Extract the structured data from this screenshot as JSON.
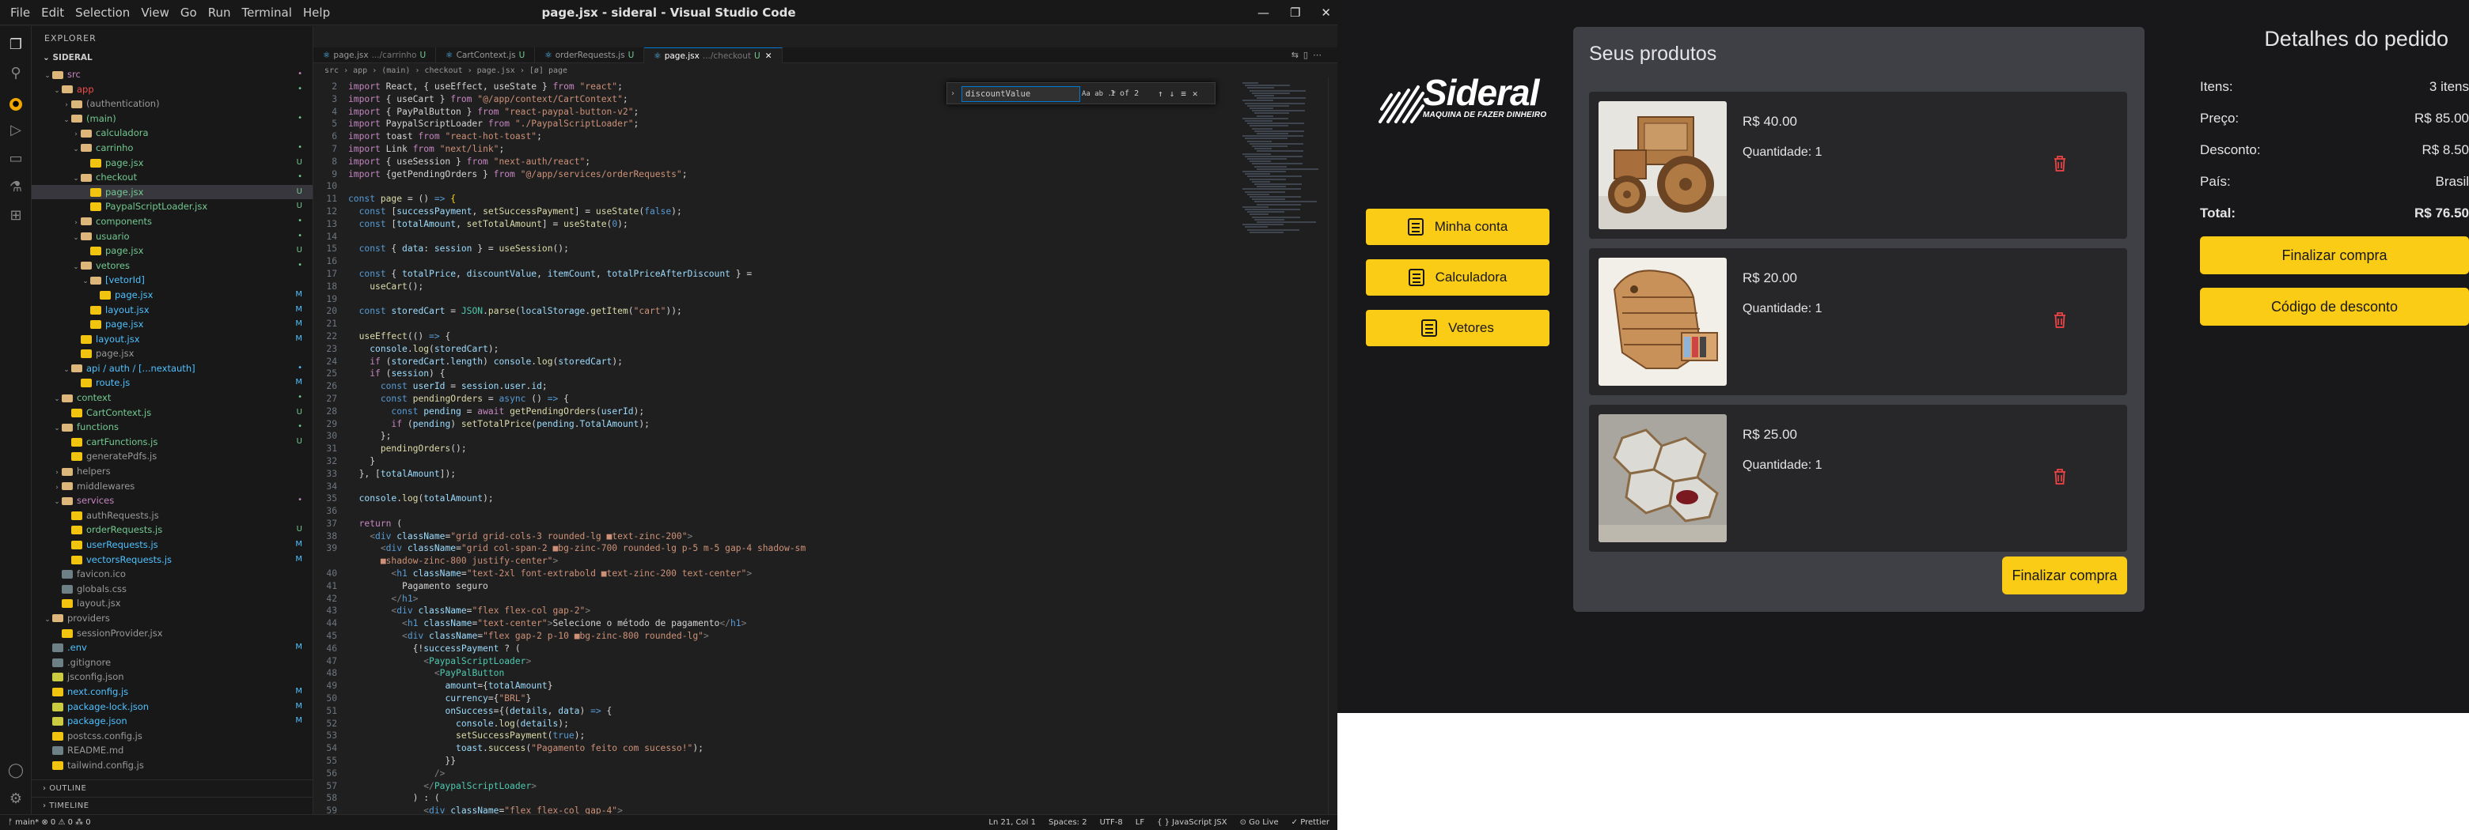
{
  "vscode": {
    "title": "page.jsx - sideral - Visual Studio Code",
    "menu": [
      "File",
      "Edit",
      "Selection",
      "View",
      "Go",
      "Run",
      "Terminal",
      "Help"
    ],
    "explorer_label": "EXPLORER",
    "root": "SIDERAL",
    "tree": [
      {
        "label": "src",
        "depth": 0,
        "folder": true,
        "open": true,
        "color": "#c586c0",
        "status": "•",
        "scolor": "#c586c0"
      },
      {
        "label": "app",
        "depth": 1,
        "folder": true,
        "open": true,
        "color": "#f14c4c",
        "status": "•",
        "scolor": "#73c991"
      },
      {
        "label": "(authentication)",
        "depth": 2,
        "folder": true,
        "open": false,
        "color": "#999",
        "status": "",
        "scolor": ""
      },
      {
        "label": "(main)",
        "depth": 2,
        "folder": true,
        "open": true,
        "color": "#73c991",
        "status": "•",
        "scolor": "#73c991"
      },
      {
        "label": "calculadora",
        "depth": 3,
        "folder": true,
        "open": false,
        "color": "#73c991",
        "status": "",
        "scolor": ""
      },
      {
        "label": "carrinho",
        "depth": 3,
        "folder": true,
        "open": true,
        "color": "#73c991",
        "status": "•",
        "scolor": "#73c991"
      },
      {
        "label": "page.jsx",
        "depth": 4,
        "folder": false,
        "color": "#73c991",
        "status": "U",
        "scolor": "#73c991"
      },
      {
        "label": "checkout",
        "depth": 3,
        "folder": true,
        "open": true,
        "color": "#73c991",
        "status": "•",
        "scolor": "#73c991"
      },
      {
        "label": "page.jsx",
        "depth": 4,
        "folder": false,
        "color": "#73c991",
        "status": "U",
        "scolor": "#73c991",
        "selected": true
      },
      {
        "label": "PaypalScriptLoader.jsx",
        "depth": 4,
        "folder": false,
        "color": "#73c991",
        "status": "U",
        "scolor": "#73c991"
      },
      {
        "label": "components",
        "depth": 3,
        "folder": true,
        "open": false,
        "color": "#73c991",
        "status": "•",
        "scolor": "#73c991"
      },
      {
        "label": "usuario",
        "depth": 3,
        "folder": true,
        "open": true,
        "color": "#73c991",
        "status": "•",
        "scolor": "#73c991"
      },
      {
        "label": "page.jsx",
        "depth": 4,
        "folder": false,
        "color": "#73c991",
        "status": "U",
        "scolor": "#73c991"
      },
      {
        "label": "vetores",
        "depth": 3,
        "folder": true,
        "open": true,
        "color": "#73c991",
        "status": "•",
        "scolor": "#73c991"
      },
      {
        "label": "[vetorId]",
        "depth": 4,
        "folder": true,
        "open": true,
        "color": "#4fc1ff",
        "status": "",
        "scolor": ""
      },
      {
        "label": "page.jsx",
        "depth": 5,
        "folder": false,
        "color": "#4fc1ff",
        "status": "M",
        "scolor": "#4fc1ff"
      },
      {
        "label": "layout.jsx",
        "depth": 4,
        "folder": false,
        "color": "#4fc1ff",
        "status": "M",
        "scolor": "#4fc1ff"
      },
      {
        "label": "page.jsx",
        "depth": 4,
        "folder": false,
        "color": "#4fc1ff",
        "status": "M",
        "scolor": "#4fc1ff"
      },
      {
        "label": "layout.jsx",
        "depth": 3,
        "folder": false,
        "color": "#4fc1ff",
        "status": "M",
        "scolor": "#4fc1ff"
      },
      {
        "label": "page.jsx",
        "depth": 3,
        "folder": false,
        "color": "#999",
        "status": "",
        "scolor": ""
      },
      {
        "label": "api / auth / [...nextauth]",
        "depth": 2,
        "folder": true,
        "open": true,
        "color": "#4fc1ff",
        "status": "•",
        "scolor": "#4fc1ff"
      },
      {
        "label": "route.js",
        "depth": 3,
        "folder": false,
        "color": "#4fc1ff",
        "status": "M",
        "scolor": "#4fc1ff"
      },
      {
        "label": "context",
        "depth": 1,
        "folder": true,
        "open": true,
        "color": "#73c991",
        "status": "•",
        "scolor": "#73c991"
      },
      {
        "label": "CartContext.js",
        "depth": 2,
        "folder": false,
        "color": "#73c991",
        "status": "U",
        "scolor": "#73c991"
      },
      {
        "label": "functions",
        "depth": 1,
        "folder": true,
        "open": true,
        "color": "#73c991",
        "status": "•",
        "scolor": "#73c991"
      },
      {
        "label": "cartFunctions.js",
        "depth": 2,
        "folder": false,
        "color": "#73c991",
        "status": "U",
        "scolor": "#73c991"
      },
      {
        "label": "generatePdfs.js",
        "depth": 2,
        "folder": false,
        "color": "#999",
        "status": "",
        "scolor": ""
      },
      {
        "label": "helpers",
        "depth": 1,
        "folder": true,
        "open": false,
        "color": "#999",
        "status": "",
        "scolor": ""
      },
      {
        "label": "middlewares",
        "depth": 1,
        "folder": true,
        "open": false,
        "color": "#999",
        "status": "",
        "scolor": ""
      },
      {
        "label": "services",
        "depth": 1,
        "folder": true,
        "open": true,
        "color": "#c586c0",
        "status": "•",
        "scolor": "#c586c0"
      },
      {
        "label": "authRequests.js",
        "depth": 2,
        "folder": false,
        "color": "#999",
        "status": "",
        "scolor": ""
      },
      {
        "label": "orderRequests.js",
        "depth": 2,
        "folder": false,
        "color": "#73c991",
        "status": "U",
        "scolor": "#73c991"
      },
      {
        "label": "userRequests.js",
        "depth": 2,
        "folder": false,
        "color": "#4fc1ff",
        "status": "M",
        "scolor": "#4fc1ff"
      },
      {
        "label": "vectorsRequests.js",
        "depth": 2,
        "folder": false,
        "color": "#4fc1ff",
        "status": "M",
        "scolor": "#4fc1ff"
      },
      {
        "label": "favicon.ico",
        "depth": 1,
        "folder": false,
        "color": "#999",
        "status": "",
        "scolor": ""
      },
      {
        "label": "globals.css",
        "depth": 1,
        "folder": false,
        "color": "#999",
        "status": "",
        "scolor": ""
      },
      {
        "label": "layout.jsx",
        "depth": 1,
        "folder": false,
        "color": "#999",
        "status": "",
        "scolor": ""
      },
      {
        "label": "providers",
        "depth": 0,
        "folder": true,
        "open": true,
        "color": "#999",
        "status": "",
        "scolor": ""
      },
      {
        "label": "sessionProvider.jsx",
        "depth": 1,
        "folder": false,
        "color": "#999",
        "status": "",
        "scolor": ""
      },
      {
        "label": ".env",
        "depth": 0,
        "folder": false,
        "color": "#4fc1ff",
        "status": "M",
        "scolor": "#4fc1ff"
      },
      {
        "label": ".gitignore",
        "depth": 0,
        "folder": false,
        "color": "#999",
        "status": "",
        "scolor": ""
      },
      {
        "label": "jsconfig.json",
        "depth": 0,
        "folder": false,
        "color": "#999",
        "status": "",
        "scolor": ""
      },
      {
        "label": "next.config.js",
        "depth": 0,
        "folder": false,
        "color": "#4fc1ff",
        "status": "M",
        "scolor": "#4fc1ff"
      },
      {
        "label": "package-lock.json",
        "depth": 0,
        "folder": false,
        "color": "#4fc1ff",
        "status": "M",
        "scolor": "#4fc1ff"
      },
      {
        "label": "package.json",
        "depth": 0,
        "folder": false,
        "color": "#4fc1ff",
        "status": "M",
        "scolor": "#4fc1ff"
      },
      {
        "label": "postcss.config.js",
        "depth": 0,
        "folder": false,
        "color": "#999",
        "status": "",
        "scolor": ""
      },
      {
        "label": "README.md",
        "depth": 0,
        "folder": false,
        "color": "#999",
        "status": "",
        "scolor": ""
      },
      {
        "label": "tailwind.config.js",
        "depth": 0,
        "folder": false,
        "color": "#999",
        "status": "",
        "scolor": ""
      }
    ],
    "outline_label": "OUTLINE",
    "timeline_label": "TIMELINE",
    "tabs": [
      {
        "label": "page.jsx",
        "sub": ".../carrinho",
        "status": "U",
        "active": false
      },
      {
        "label": "CartContext.js",
        "sub": "",
        "status": "U",
        "active": false
      },
      {
        "label": "orderRequests.js",
        "sub": "",
        "status": "U",
        "active": false
      },
      {
        "label": "page.jsx",
        "sub": ".../checkout",
        "status": "U",
        "active": true
      }
    ],
    "breadcrumb": "src › app › (main) › checkout › page.jsx › [ø] page",
    "find": {
      "value": "discountValue",
      "count": "1 of 2",
      "options": "Aa ab .*"
    },
    "code_lines": [
      "<span class='k'>import</span> React, { useEffect, useState } <span class='k'>from</span> <span class='s'>\"react\"</span>;",
      "<span class='k'>import</span> { useCart } <span class='k'>from</span> <span class='s'>\"@/app/context/CartContext\"</span>;",
      "<span class='k'>import</span> { PayPalButton } <span class='k'>from</span> <span class='s'>\"react-paypal-button-v2\"</span>;",
      "<span class='k'>import</span> PaypalScriptLoader <span class='k'>from</span> <span class='s'>\"./PaypalScriptLoader\"</span>;",
      "<span class='k'>import</span> toast <span class='k'>from</span> <span class='s'>\"react-hot-toast\"</span>;",
      "<span class='k'>import</span> Link <span class='k'>from</span> <span class='s'>\"next/link\"</span>;",
      "<span class='k'>import</span> { useSession } <span class='k'>from</span> <span class='s'>\"next-auth/react\"</span>;",
      "<span class='k'>import</span> {getPendingOrders } <span class='k'>from</span> <span class='s'>\"@/app/services/orderRequests\"</span>;",
      "",
      "<span class='b'>const</span> <span class='f'>page</span> = () <span class='b'>=&gt;</span> <span class='y'>{</span>",
      "  <span class='b'>const</span> [<span class='v'>successPayment</span>, <span class='f'>setSuccessPayment</span>] = <span class='f'>useState</span>(<span class='b'>false</span>);",
      "  <span class='b'>const</span> [<span class='v'>totalAmount</span>, <span class='f'>setTotalAmount</span>] = <span class='f'>useState</span>(<span class='b'>0</span>);",
      "",
      "  <span class='b'>const</span> { <span class='v'>data</span>: <span class='v'>session</span> } = <span class='f'>useSession</span>();",
      "",
      "  <span class='b'>const</span> { <span class='v'>totalPrice</span>, <span class='v'>discountValue</span>, <span class='v'>itemCount</span>, <span class='v'>totalPriceAfterDiscount</span> } =",
      "    <span class='f'>useCart</span>();",
      "",
      "  <span class='b'>const</span> <span class='v'>storedCart</span> = <span class='t'>JSON</span>.<span class='f'>parse</span>(<span class='v'>localStorage</span>.<span class='f'>getItem</span>(<span class='s'>\"cart\"</span>));",
      "",
      "  <span class='f'>useEffect</span>(() <span class='b'>=&gt;</span> {",
      "    <span class='v'>console</span>.<span class='f'>log</span>(<span class='v'>storedCart</span>);",
      "    <span class='k'>if</span> (<span class='v'>storedCart</span>.<span class='v'>length</span>) <span class='v'>console</span>.<span class='f'>log</span>(<span class='v'>storedCart</span>);",
      "    <span class='k'>if</span> (<span class='v'>session</span>) {",
      "      <span class='b'>const</span> <span class='v'>userId</span> = <span class='v'>session</span>.<span class='v'>user</span>.<span class='v'>id</span>;",
      "      <span class='b'>const</span> <span class='f'>pendingOrders</span> = <span class='b'>async</span> () <span class='b'>=&gt;</span> {",
      "        <span class='b'>const</span> <span class='v'>pending</span> = <span class='k'>await</span> <span class='f'>getPendingOrders</span>(<span class='v'>userId</span>);",
      "        <span class='k'>if</span> (<span class='v'>pending</span>) <span class='f'>setTotalPrice</span>(<span class='v'>pending</span>.<span class='v'>TotalAmount</span>);",
      "      };",
      "      <span class='f'>pendingOrders</span>();",
      "    }",
      "  }, [<span class='v'>totalAmount</span>]);",
      "",
      "  <span class='v'>console</span>.<span class='f'>log</span>(<span class='v'>totalAmount</span>);",
      "",
      "  <span class='k'>return</span> (",
      "    <span class='g'>&lt;</span><span class='b'>div</span> <span class='v'>className</span>=<span class='s'>\"grid grid-cols-3 rounded-lg ■text-zinc-200\"</span><span class='g'>&gt;</span>",
      "      <span class='g'>&lt;</span><span class='b'>div</span> <span class='v'>className</span>=<span class='s'>\"grid col-span-2 ■bg-zinc-700 rounded-lg p-5 m-5 gap-4 shadow-sm</span>",
      "      <span class='s'>■shadow-zinc-800 justify-center\"</span><span class='g'>&gt;</span>",
      "        <span class='g'>&lt;</span><span class='b'>h1</span> <span class='v'>className</span>=<span class='s'>\"text-2xl font-extrabold ■text-zinc-200 text-center\"</span><span class='g'>&gt;</span>",
      "          Pagamento seguro",
      "        <span class='g'>&lt;/</span><span class='b'>h1</span><span class='g'>&gt;</span>",
      "        <span class='g'>&lt;</span><span class='b'>div</span> <span class='v'>className</span>=<span class='s'>\"flex flex-col gap-2\"</span><span class='g'>&gt;</span>",
      "          <span class='g'>&lt;</span><span class='b'>h1</span> <span class='v'>className</span>=<span class='s'>\"text-center\"</span><span class='g'>&gt;</span>Selecione o método de pagamento<span class='g'>&lt;/</span><span class='b'>h1</span><span class='g'>&gt;</span>",
      "          <span class='g'>&lt;</span><span class='b'>div</span> <span class='v'>className</span>=<span class='s'>\"flex gap-2 p-10 ■bg-zinc-800 rounded-lg\"</span><span class='g'>&gt;</span>",
      "            {!<span class='v'>successPayment</span> ? (",
      "              <span class='g'>&lt;</span><span class='t'>PaypalScriptLoader</span><span class='g'>&gt;</span>",
      "                <span class='g'>&lt;</span><span class='t'>PayPalButton</span>",
      "                  <span class='v'>amount</span>={<span class='v'>totalAmount</span>}",
      "                  <span class='v'>currency</span>={<span class='s'>\"BRL\"</span>}",
      "                  <span class='v'>onSuccess</span>={(<span class='v'>details</span>, <span class='v'>data</span>) <span class='b'>=&gt;</span> {",
      "                    <span class='v'>console</span>.<span class='f'>log</span>(<span class='v'>details</span>);",
      "                    <span class='f'>setSuccessPayment</span>(<span class='b'>true</span>);",
      "                    <span class='v'>toast</span>.<span class='f'>success</span>(<span class='s'>\"Pagamento feito com sucesso!\"</span>);",
      "                  }}",
      "                <span class='g'>/&gt;</span>",
      "              <span class='g'>&lt;/</span><span class='t'>PaypalScriptLoader</span><span class='g'>&gt;</span>",
      "            ) : (",
      "              <span class='g'>&lt;</span><span class='b'>div</span> <span class='v'>className</span>=<span class='s'>\"flex flex-col gap-4\"</span><span class='g'>&gt;</span>"
    ],
    "line_numbers": [
      "2",
      "3",
      "4",
      "5",
      "6",
      "7",
      "8",
      "9",
      "10",
      "11",
      "12",
      "13",
      "14",
      "15",
      "16",
      "17",
      "18",
      "19",
      "20",
      "21",
      "22",
      "23",
      "24",
      "25",
      "26",
      "27",
      "28",
      "29",
      "30",
      "31",
      "32",
      "33",
      "34",
      "35",
      "36",
      "37",
      "38",
      "39",
      "",
      "40",
      "41",
      "42",
      "43",
      "44",
      "45",
      "46",
      "47",
      "48",
      "49",
      "50",
      "51",
      "52",
      "53",
      "54",
      "55",
      "56",
      "57",
      "58",
      "59"
    ],
    "status_left": "ᚠ main*  ⊗ 0 ⚠ 0   ⁂ 0",
    "status_right": [
      "Ln 21, Col 1",
      "Spaces: 2",
      "UTF-8",
      "LF",
      "{ } JavaScript JSX",
      "⊙ Go Live",
      "✓ Prettier"
    ]
  },
  "app": {
    "logo_word": "Sideral",
    "logo_tagline": "MAQUINA DE FAZER DINHEIRO",
    "nav": [
      {
        "label": "Minha conta",
        "icon": "calculator-icon"
      },
      {
        "label": "Calculadora",
        "icon": "calculator-icon"
      },
      {
        "label": "Vetores",
        "icon": "calculator-icon"
      }
    ],
    "products_title": "Seus produtos",
    "products": [
      {
        "price": "R$ 40.00",
        "quantity": "Quantidade: 1",
        "image": "wooden-tractor"
      },
      {
        "price": "R$ 20.00",
        "quantity": "Quantidade: 1",
        "image": "wooden-gorilla-shelf"
      },
      {
        "price": "R$ 25.00",
        "quantity": "Quantidade: 1",
        "image": "hexagon-wine-rack"
      }
    ],
    "finalizar_bottom": "Finalizar compra",
    "details": {
      "title": "Detalhes do pedido",
      "rows": [
        {
          "label": "Itens:",
          "value": "3 itens",
          "bold": false
        },
        {
          "label": "Preço:",
          "value": "R$ 85.00",
          "bold": false
        },
        {
          "label": "Desconto:",
          "value": "R$ 8.50",
          "bold": false
        },
        {
          "label": "País:",
          "value": "Brasil",
          "bold": false
        },
        {
          "label": "Total:",
          "value": "R$ 76.50",
          "bold": true
        }
      ],
      "finalizar": "Finalizar compra",
      "codigo": "Código de desconto"
    },
    "colors": {
      "accent": "#facc15",
      "bg": "#18181b",
      "panel": "#3f3f46",
      "card": "#27272a",
      "trash": "#ef4444"
    }
  }
}
